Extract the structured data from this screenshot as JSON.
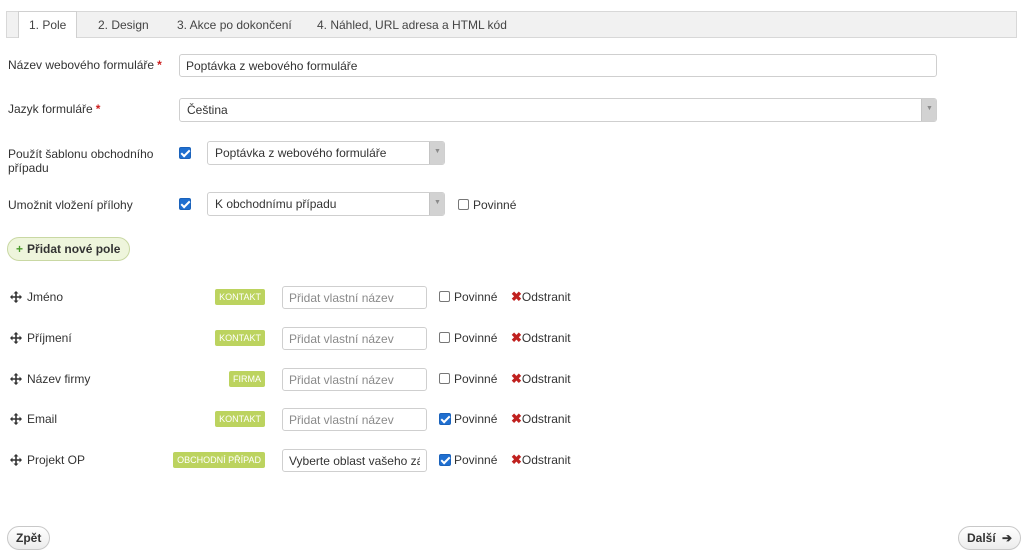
{
  "tabs": [
    {
      "label": "1. Pole",
      "active": true
    },
    {
      "label": "2. Design",
      "active": false
    },
    {
      "label": "3. Akce po dokončení",
      "active": false
    },
    {
      "label": "4. Náhled, URL adresa a HTML kód",
      "active": false
    }
  ],
  "form": {
    "name_label": "Název webového formuláře",
    "name_value": "Poptávka z webového formuláře",
    "language_label": "Jazyk formuláře",
    "language_value": "Čeština",
    "template_label": "Použít šablonu obchodního případu",
    "template_checked": true,
    "template_value": "Poptávka z webového formuláře",
    "attachment_label": "Umožnit vložení přílohy",
    "attachment_checked": true,
    "attachment_value": "K obchodnímu případu",
    "attachment_required_label": "Povinné",
    "attachment_required_checked": false,
    "required_marker": "*"
  },
  "add_field_label": "Přidat nové pole",
  "fields": [
    {
      "name": "Jméno",
      "badge": "KONTAKT",
      "placeholder": "Přidat vlastní název",
      "value": "",
      "required_checked": false,
      "required_label": "Povinné",
      "remove_label": "Odstranit"
    },
    {
      "name": "Příjmení",
      "badge": "KONTAKT",
      "placeholder": "Přidat vlastní název",
      "value": "",
      "required_checked": false,
      "required_label": "Povinné",
      "remove_label": "Odstranit"
    },
    {
      "name": "Název firmy",
      "badge": "FIRMA",
      "placeholder": "Přidat vlastní název",
      "value": "",
      "required_checked": false,
      "required_label": "Povinné",
      "remove_label": "Odstranit"
    },
    {
      "name": "Email",
      "badge": "KONTAKT",
      "placeholder": "Přidat vlastní název",
      "value": "",
      "required_checked": true,
      "required_label": "Povinné",
      "remove_label": "Odstranit"
    },
    {
      "name": "Projekt OP",
      "badge": "OBCHODNÍ PŘÍPAD",
      "placeholder": "",
      "value": "Vyberte oblast vašeho zájm",
      "required_checked": true,
      "required_label": "Povinné",
      "remove_label": "Odstranit"
    }
  ],
  "nav": {
    "back_label": "Zpět",
    "next_label": "Další"
  },
  "colors": {
    "badge": "#bcd35f",
    "checkbox": "#1f6fd0",
    "remove_x": "#c0211f",
    "required": "#cc1f1f"
  }
}
